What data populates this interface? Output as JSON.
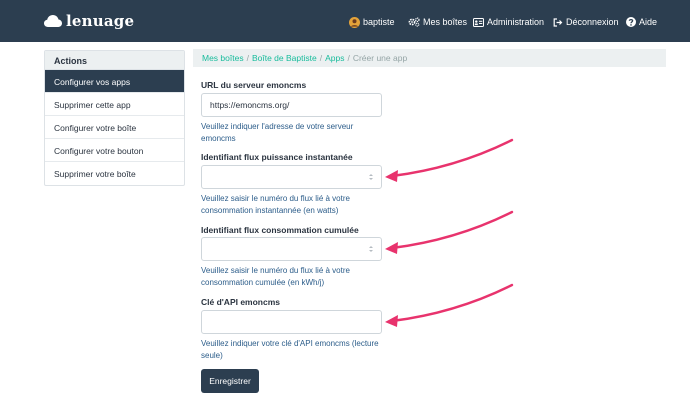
{
  "navbar": {
    "brand": "lenuage",
    "items": [
      {
        "label": "baptiste",
        "icon": "user-avatar-icon"
      },
      {
        "label": "Mes boîtes",
        "icon": "cogs-icon"
      },
      {
        "label": "Administration",
        "icon": "admin-card-icon"
      },
      {
        "label": "Déconnexion",
        "icon": "sign-out-icon"
      },
      {
        "label": "Aide",
        "icon": "question-circle-icon"
      }
    ]
  },
  "sidebar": {
    "heading": "Actions",
    "items": [
      {
        "label": "Configurer vos apps"
      },
      {
        "label": "Supprimer cette app"
      },
      {
        "label": "Configurer votre boîte"
      },
      {
        "label": "Configurer votre bouton"
      },
      {
        "label": "Supprimer votre boîte"
      }
    ]
  },
  "breadcrumb": {
    "links": [
      "Mes boîtes",
      "Boîte de Baptiste",
      "Apps"
    ],
    "current": "Créer une app"
  },
  "form": {
    "fields": [
      {
        "label": "URL du serveur emoncms",
        "value": "https://emoncms.org/",
        "help": "Veuillez indiquer l'adresse de votre serveur emoncms"
      },
      {
        "label": "Identifiant flux puissance instantanée",
        "value": "",
        "help": "Veuillez saisir le numéro du flux lié à votre consommation instantannée (en watts)"
      },
      {
        "label": "Identifiant flux consommation cumulée",
        "value": "",
        "help": "Veuillez saisir le numéro du flux lié à votre consommation cumulée (en kWh/j)"
      },
      {
        "label": "Clé d'API emoncms",
        "value": "",
        "help": "Veuillez indiquer votre clé d'API emoncms (lecture seule)"
      }
    ],
    "submit_label": "Enregistrer"
  },
  "colors": {
    "navbar": "#2c3e50",
    "link": "#18bc9c",
    "help_text": "#2c5d8a",
    "annotation_arrow": "#e8336d"
  }
}
